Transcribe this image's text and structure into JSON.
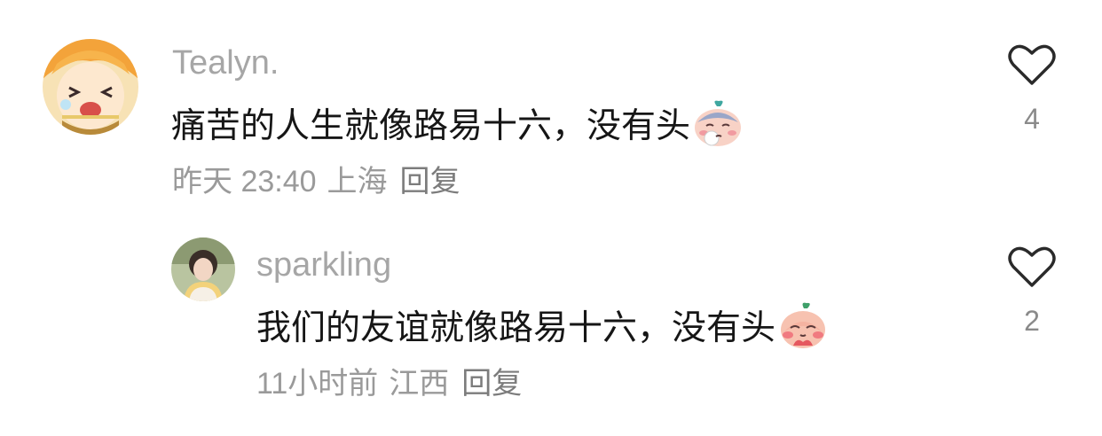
{
  "comments": [
    {
      "username": "Tealyn.",
      "text": "痛苦的人生就像路易十六，没有头",
      "sticker": "sad-peach-sticker",
      "time": "昨天 23:40",
      "location": "上海",
      "reply_label": "回复",
      "likes": "4",
      "like_icon": "heart-outline-icon"
    },
    {
      "username": "sparkling",
      "text": "我们的友谊就像路易十六，没有头",
      "sticker": "shy-peach-sticker",
      "time": "11小时前",
      "location": "江西",
      "reply_label": "回复",
      "likes": "2",
      "like_icon": "heart-outline-icon"
    }
  ],
  "colors": {
    "username": "#a6a6a6",
    "text": "#161616",
    "meta": "#9a9a9a",
    "heart": "#2a2a2a"
  }
}
